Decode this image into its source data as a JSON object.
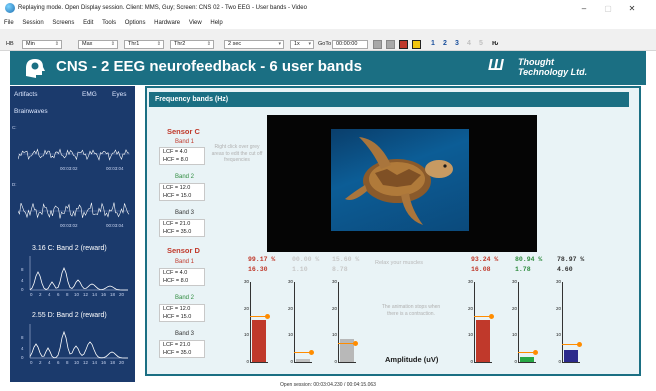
{
  "window": {
    "title": "Replaying mode. Open Display session. Client: MMS, Guy; Screen: CNS 02 - Two EEG - User bands - Video",
    "controls": [
      "–",
      "▢",
      "✕"
    ]
  },
  "menu": [
    "File",
    "Session",
    "Screens",
    "Edit",
    "Tools",
    "Options",
    "Hardware",
    "View",
    "Help"
  ],
  "toolbar": {
    "hb_label": "HB",
    "min": "Min",
    "max": "Max",
    "thr1": "Thr1",
    "thr2": "Thr2",
    "duration": "2 sec",
    "speed": "1x",
    "goto_label": "GoTo",
    "goto_value": "00:00:00",
    "pages": [
      "1",
      "2",
      "3",
      "4",
      "5"
    ],
    "record_color": "#c0392b",
    "pause_color": "#f1c40f"
  },
  "header": {
    "title": "CNS - 2 EEG neurofeedback - 6 user bands",
    "logo_line1": "Thought",
    "logo_line2": "Technology Ltd.",
    "color": "#1b6f83"
  },
  "left": {
    "links": [
      "Artifacts",
      "EMG",
      "Eyes"
    ],
    "section": "Brainwaves",
    "wave1": {
      "channel": "C:",
      "t1": "00:03:02",
      "t2": "00:03:04"
    },
    "wave2": {
      "channel": "D:",
      "t1": "00:03:02",
      "t2": "00:03:04"
    },
    "spec1_caption": "3.16  C: Band 2 (reward)",
    "spec2_caption": "2.55  D: Band 2 (reward)",
    "spec_ticks": [
      "0",
      "2",
      "4",
      "6",
      "8",
      "10",
      "12",
      "14",
      "16",
      "18",
      "20"
    ],
    "spec_yticks": [
      "8",
      "4",
      "0"
    ]
  },
  "main": {
    "panel_title": "Frequency bands (Hz)",
    "hint": "Right click over grey areas to edit the cut off frequencies",
    "sensor_c": {
      "title": "Sensor C",
      "bands": [
        {
          "label": "Band 1",
          "lcf": "LCF = 4.0",
          "hcf": "HCF = 8.0"
        },
        {
          "label": "Band 2",
          "lcf": "LCF = 12.0",
          "hcf": "HCF = 15.0"
        },
        {
          "label": "Band 3",
          "lcf": "LCF = 21.0",
          "hcf": "HCF = 35.0"
        }
      ]
    },
    "sensor_d": {
      "title": "Sensor D",
      "bands": [
        {
          "label": "Band 1",
          "lcf": "LCF = 4.0",
          "hcf": "HCF = 8.0"
        },
        {
          "label": "Band 2",
          "lcf": "LCF = 12.0",
          "hcf": "HCF = 15.0"
        },
        {
          "label": "Band 3",
          "lcf": "LCF = 21.0",
          "hcf": "HCF = 35.0"
        }
      ]
    },
    "relax_text": "Relax your muscles",
    "faded_text": "The animation stops when there is a contraction.",
    "amplitude_label": "Amplitude (uV)",
    "gauge_yticks": [
      "30",
      "20",
      "10",
      "0"
    ],
    "gauges": [
      {
        "pct": "99.17 %",
        "value": "16.30",
        "pct_color": "#c0392b",
        "val_color": "#c0392b",
        "bar_color": "#c0392b",
        "level": 0.53,
        "threshold": 0.57,
        "faded": false
      },
      {
        "pct": "00.00 %",
        "value": "1.10",
        "pct_color": "#c8c8c8",
        "val_color": "#c8c8c8",
        "bar_color": "#c0c0c0",
        "level": 0.02,
        "threshold": 0.12,
        "faded": true
      },
      {
        "pct": "15.60 %",
        "value": "8.78",
        "pct_color": "#c8c8c8",
        "val_color": "#c8c8c8",
        "bar_color": "#b8b8b8",
        "level": 0.29,
        "threshold": 0.24,
        "faded": true
      },
      {
        "pct": "93.24 %",
        "value": "16.08",
        "pct_color": "#c0392b",
        "val_color": "#c0392b",
        "bar_color": "#c0392b",
        "level": 0.53,
        "threshold": 0.57,
        "faded": false
      },
      {
        "pct": "80.94 %",
        "value": "1.78",
        "pct_color": "#2e8b3e",
        "val_color": "#2e8b3e",
        "bar_color": "#27a844",
        "level": 0.06,
        "threshold": 0.12,
        "faded": false
      },
      {
        "pct": "78.97 %",
        "value": "4.60",
        "pct_color": "#333333",
        "val_color": "#333333",
        "bar_color": "#2c2a8c",
        "level": 0.15,
        "threshold": 0.22,
        "faded": false
      }
    ]
  },
  "status": "Open session: 00:03:04.230 / 00:04:15.063"
}
